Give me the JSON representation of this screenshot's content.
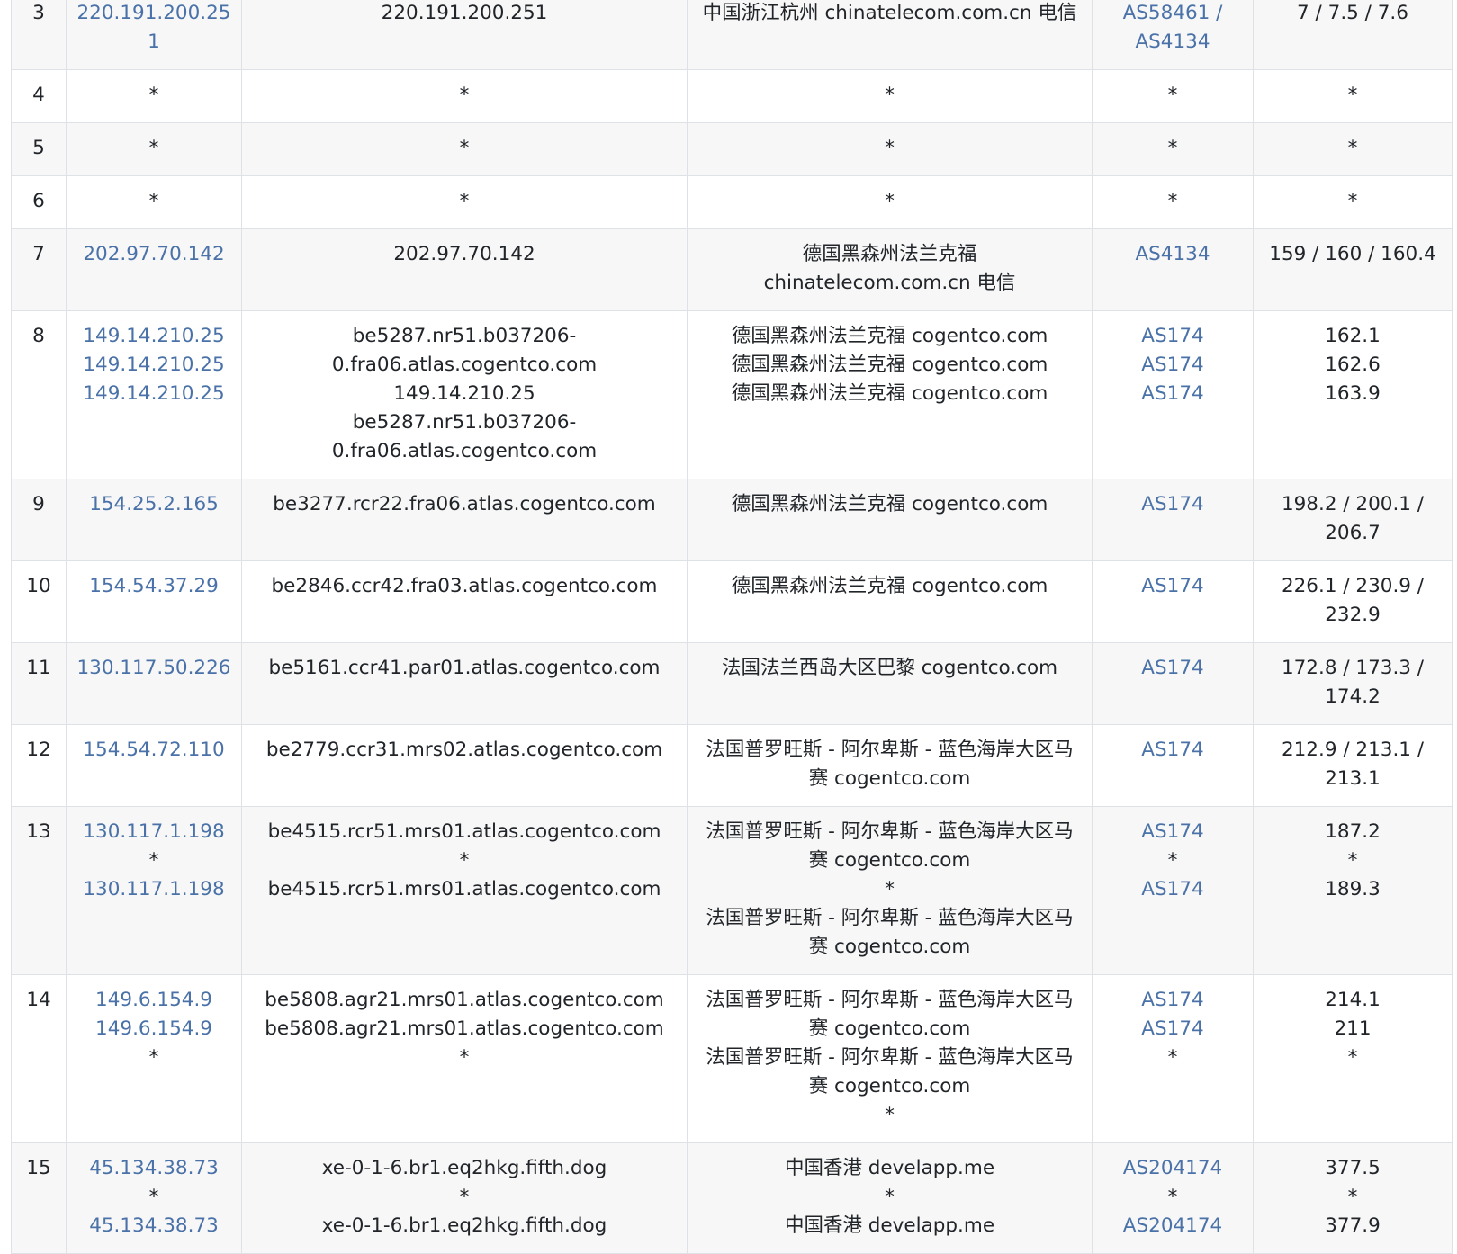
{
  "rows": [
    {
      "hop": "3",
      "ip": [
        "220.191.200.251"
      ],
      "host": [
        "220.191.200.251"
      ],
      "location": [
        "中国浙江杭州 chinatelecom.com.cn 电信"
      ],
      "asn": [
        "AS58461 / AS4134"
      ],
      "latency": [
        "7 / 7.5 / 7.6"
      ]
    },
    {
      "hop": "4",
      "ip": [
        "*"
      ],
      "host": [
        "*"
      ],
      "location": [
        "*"
      ],
      "asn": [
        "*"
      ],
      "latency": [
        "*"
      ]
    },
    {
      "hop": "5",
      "ip": [
        "*"
      ],
      "host": [
        "*"
      ],
      "location": [
        "*"
      ],
      "asn": [
        "*"
      ],
      "latency": [
        "*"
      ]
    },
    {
      "hop": "6",
      "ip": [
        "*"
      ],
      "host": [
        "*"
      ],
      "location": [
        "*"
      ],
      "asn": [
        "*"
      ],
      "latency": [
        "*"
      ]
    },
    {
      "hop": "7",
      "ip": [
        "202.97.70.142"
      ],
      "host": [
        "202.97.70.142"
      ],
      "location": [
        "德国黑森州法兰克福 chinatelecom.com.cn 电信"
      ],
      "asn": [
        "AS4134"
      ],
      "latency": [
        "159 / 160 / 160.4"
      ]
    },
    {
      "hop": "8",
      "ip": [
        "149.14.210.25",
        "149.14.210.25",
        "149.14.210.25"
      ],
      "host": [
        "be5287.nr51.b037206-0.fra06.atlas.cogentco.com",
        "149.14.210.25",
        "be5287.nr51.b037206-0.fra06.atlas.cogentco.com"
      ],
      "location": [
        "德国黑森州法兰克福 cogentco.com",
        "德国黑森州法兰克福 cogentco.com",
        "德国黑森州法兰克福 cogentco.com"
      ],
      "asn": [
        "AS174",
        "AS174",
        "AS174"
      ],
      "latency": [
        "162.1",
        "162.6",
        "163.9"
      ]
    },
    {
      "hop": "9",
      "ip": [
        "154.25.2.165"
      ],
      "host": [
        "be3277.rcr22.fra06.atlas.cogentco.com"
      ],
      "location": [
        "德国黑森州法兰克福 cogentco.com"
      ],
      "asn": [
        "AS174"
      ],
      "latency": [
        "198.2 / 200.1 / 206.7"
      ]
    },
    {
      "hop": "10",
      "ip": [
        "154.54.37.29"
      ],
      "host": [
        "be2846.ccr42.fra03.atlas.cogentco.com"
      ],
      "location": [
        "德国黑森州法兰克福 cogentco.com"
      ],
      "asn": [
        "AS174"
      ],
      "latency": [
        "226.1 / 230.9 / 232.9"
      ]
    },
    {
      "hop": "11",
      "ip": [
        "130.117.50.226"
      ],
      "host": [
        "be5161.ccr41.par01.atlas.cogentco.com"
      ],
      "location": [
        "法国法兰西岛大区巴黎 cogentco.com"
      ],
      "asn": [
        "AS174"
      ],
      "latency": [
        "172.8 / 173.3 / 174.2"
      ]
    },
    {
      "hop": "12",
      "ip": [
        "154.54.72.110"
      ],
      "host": [
        "be2779.ccr31.mrs02.atlas.cogentco.com"
      ],
      "location": [
        "法国普罗旺斯 - 阿尔卑斯 - 蓝色海岸大区马赛 cogentco.com"
      ],
      "asn": [
        "AS174"
      ],
      "latency": [
        "212.9 / 213.1 / 213.1"
      ]
    },
    {
      "hop": "13",
      "ip": [
        "130.117.1.198",
        "*",
        "130.117.1.198"
      ],
      "host": [
        "be4515.rcr51.mrs01.atlas.cogentco.com",
        "*",
        "be4515.rcr51.mrs01.atlas.cogentco.com"
      ],
      "location": [
        "法国普罗旺斯 - 阿尔卑斯 - 蓝色海岸大区马赛 cogentco.com",
        "*",
        "法国普罗旺斯 - 阿尔卑斯 - 蓝色海岸大区马赛 cogentco.com"
      ],
      "asn": [
        "AS174",
        "*",
        "AS174"
      ],
      "latency": [
        "187.2",
        "*",
        "189.3"
      ]
    },
    {
      "hop": "14",
      "ip": [
        "149.6.154.9",
        "149.6.154.9",
        "*"
      ],
      "host": [
        "be5808.agr21.mrs01.atlas.cogentco.com",
        "be5808.agr21.mrs01.atlas.cogentco.com",
        "*"
      ],
      "location": [
        "法国普罗旺斯 - 阿尔卑斯 - 蓝色海岸大区马赛 cogentco.com",
        "法国普罗旺斯 - 阿尔卑斯 - 蓝色海岸大区马赛 cogentco.com",
        "*"
      ],
      "asn": [
        "AS174",
        "AS174",
        "*"
      ],
      "latency": [
        "214.1",
        "211",
        "*"
      ]
    },
    {
      "hop": "15",
      "ip": [
        "45.134.38.73",
        "*",
        "45.134.38.73"
      ],
      "host": [
        "xe-0-1-6.br1.eq2hkg.fifth.dog",
        "*",
        "xe-0-1-6.br1.eq2hkg.fifth.dog"
      ],
      "location": [
        "中国香港 develapp.me",
        "*",
        "中国香港 develapp.me"
      ],
      "asn": [
        "AS204174",
        "*",
        "AS204174"
      ],
      "latency": [
        "377.5",
        "*",
        "377.9"
      ]
    }
  ]
}
